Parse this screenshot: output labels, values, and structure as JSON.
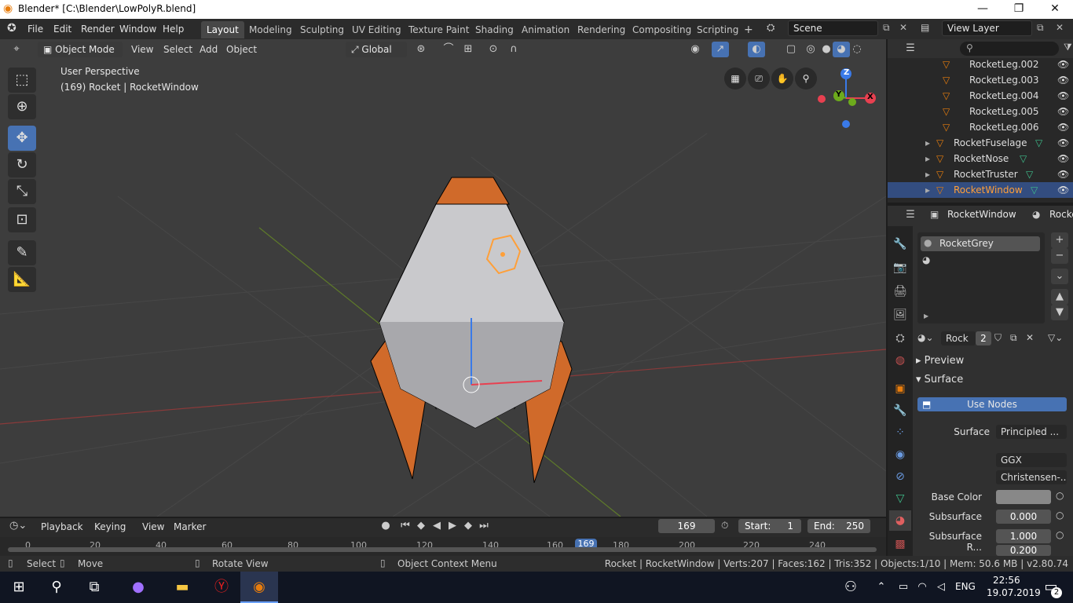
{
  "titlebar": {
    "title": "Blender* [C:\\Blender\\LowPolyR.blend]"
  },
  "menu": {
    "file": "File",
    "edit": "Edit",
    "render": "Render",
    "window": "Window",
    "help": "Help"
  },
  "workspaces": [
    "Layout",
    "Modeling",
    "Sculpting",
    "UV Editing",
    "Texture Paint",
    "Shading",
    "Animation",
    "Rendering",
    "Compositing",
    "Scripting"
  ],
  "scene": "Scene",
  "view_layer": "View Layer",
  "viewport": {
    "mode": "Object Mode",
    "view": "View",
    "select": "Select",
    "add": "Add",
    "object": "Object",
    "orientation": "Global",
    "overlay_title": "User Perspective",
    "overlay_sub": "(169) Rocket | RocketWindow",
    "gizmo": {
      "x": "X",
      "y": "Y",
      "z": "Z"
    }
  },
  "outliner": {
    "items": [
      "RocketLeg.002",
      "RocketLeg.003",
      "RocketLeg.004",
      "RocketLeg.005",
      "RocketLeg.006",
      "RocketFuselage",
      "RocketNose",
      "RocketTruster",
      "RocketWindow"
    ]
  },
  "properties": {
    "object": "RocketWindow",
    "material_tab": "Rocke",
    "slot": "RocketGrey",
    "mat_name": "Rock",
    "users": "2",
    "preview": "Preview",
    "surface_panel": "Surface",
    "use_nodes": "Use Nodes",
    "surface_label": "Surface",
    "surface_value": "Principled ...",
    "dist": "GGX",
    "sss_method": "Christensen-...",
    "base_color_label": "Base Color",
    "subsurface_label": "Subsurface",
    "subsurface_value": "0.000",
    "subsurface_r_label": "Subsurface R...",
    "subsurface_r_value": "1.000",
    "subsurface_r_value2": "0.200"
  },
  "timeline": {
    "playback": "Playback",
    "keying": "Keying",
    "view": "View",
    "marker": "Marker",
    "frame": "169",
    "start_label": "Start:",
    "start": "1",
    "end_label": "End:",
    "end": "250",
    "ruler": [
      "0",
      "20",
      "40",
      "60",
      "80",
      "100",
      "120",
      "140",
      "160",
      "169",
      "180",
      "200",
      "220",
      "240"
    ]
  },
  "status": {
    "select": "Select",
    "move": "Move",
    "rotate": "Rotate View",
    "context": "Object Context Menu",
    "info": "Rocket | RocketWindow | Verts:207 | Faces:162 | Tris:352 | Objects:1/10 | Mem: 50.6 MB | v2.80.74"
  },
  "taskbar": {
    "lang": "ENG",
    "time": "22:56",
    "date": "19.07.2019",
    "notif": "2"
  },
  "colors": {
    "accent": "#4772b3",
    "selected_obj": "#ff9f38",
    "orange": "#d06a2a"
  }
}
